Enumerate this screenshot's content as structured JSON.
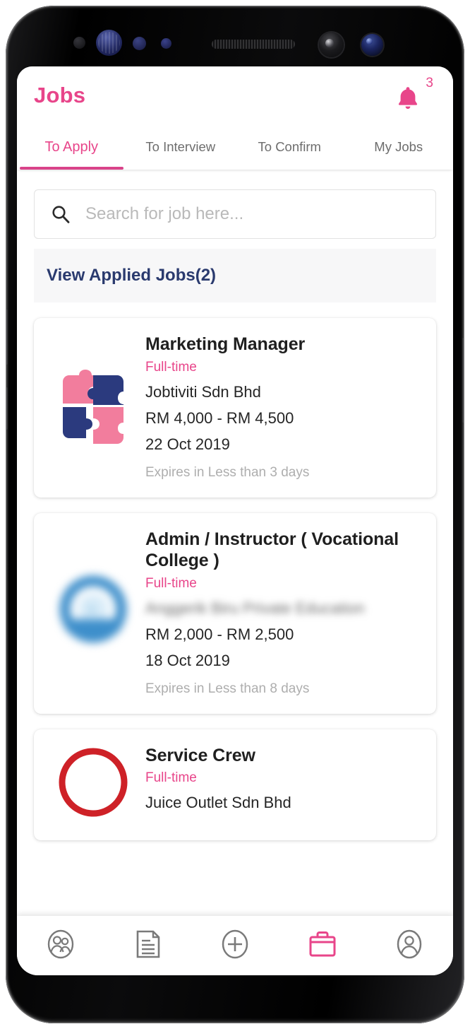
{
  "device": {
    "type": "smartphone",
    "bezel_color": "#000000"
  },
  "header": {
    "title": "Jobs",
    "title_color": "#E8458A",
    "notification_icon": "bell-icon",
    "notification_count": "3"
  },
  "tabs": [
    {
      "label": "To Apply",
      "active": true
    },
    {
      "label": "To Interview",
      "active": false
    },
    {
      "label": "To Confirm",
      "active": false
    },
    {
      "label": "My Jobs",
      "active": false
    }
  ],
  "search": {
    "icon": "search-icon",
    "placeholder": "Search for job here...",
    "value": ""
  },
  "applied_jobs": {
    "label": "View Applied Jobs(2)",
    "count": "2",
    "color": "#2A3A6E"
  },
  "jobs": [
    {
      "title": "Marketing Manager",
      "type": "Full-time",
      "company": "Jobtiviti Sdn Bhd",
      "company_blurred": false,
      "salary": "RM 4,000 - RM 4,500",
      "date": "22 Oct 2019",
      "expiry": "Expires in Less than 3 days",
      "logo": "puzzle-pieces-logo",
      "logo_colors": [
        "#F27D9D",
        "#2B3A7E"
      ]
    },
    {
      "title": "Admin / Instructor ( Vocational College )",
      "type": "Full-time",
      "company": "Anggerik Biru Private Education",
      "company_blurred": true,
      "salary": "RM 2,000 - RM 2,500",
      "date": "18 Oct 2019",
      "expiry": "Expires in Less than 8 days",
      "logo": "blue-circle-logo",
      "logo_colors": [
        "#3E8FCB"
      ]
    },
    {
      "title": "Service Crew",
      "type": "Full-time",
      "company": "Juice Outlet Sdn Bhd",
      "company_blurred": false,
      "salary": "",
      "date": "",
      "expiry": "",
      "logo": "red-circle-logo",
      "logo_colors": [
        "#CE2127"
      ]
    }
  ],
  "bottom_nav": [
    {
      "icon": "people-icon",
      "active": false
    },
    {
      "icon": "feed-icon",
      "active": false
    },
    {
      "icon": "add-icon",
      "active": false
    },
    {
      "icon": "briefcase-icon",
      "active": true
    },
    {
      "icon": "profile-icon",
      "active": false
    }
  ],
  "colors": {
    "accent_pink": "#E8458A",
    "navy": "#2A3A6E",
    "muted_gray": "#AEAEAE",
    "tab_inactive": "#6D6D6D"
  }
}
